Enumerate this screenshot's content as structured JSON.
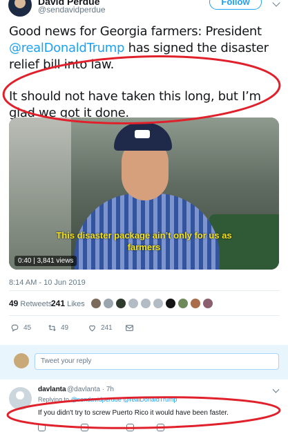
{
  "author": {
    "name": "David Perdue",
    "handle": "@sendavidperdue",
    "follow_label": "Follow"
  },
  "tweet": {
    "paragraph1": "Good news for Georgia farmers: President",
    "paragraph1_mention": "@realDonaldTrump",
    "paragraph1_end": " has signed the disaster relief bill into law.",
    "paragraph2": "It should not have taken this long, but I’m glad we got it done."
  },
  "video": {
    "subtitle_line1": "This disaster package ain’t only for us as",
    "subtitle_line2": "farmers",
    "stats": "0:40 | 3,841 views"
  },
  "timestamp": "8:14 AM - 10 Jun 2019",
  "engagement": {
    "retweets_count": "49",
    "retweets_label": "Retweets",
    "likes_count": "241",
    "likes_label": "Likes"
  },
  "actions": {
    "replies": "45",
    "retweets": "49",
    "likes": "241"
  },
  "reply_box": {
    "placeholder": "Tweet your reply"
  },
  "reply": {
    "name": "davlanta",
    "handle": "@davlanta · 7h",
    "replying_prefix": "Replying to ",
    "replying_to": "@sendavidperdue @realDonaldTrump",
    "text": "If you didn't try to screw Puerto Rico it would have been faster."
  },
  "colors": {
    "accent": "#1da1f2",
    "annotation": "#e0202a",
    "subtitle": "#f5e418"
  },
  "icons": [
    "reply-icon",
    "retweet-icon",
    "like-icon",
    "message-icon",
    "chevron-down-icon"
  ]
}
